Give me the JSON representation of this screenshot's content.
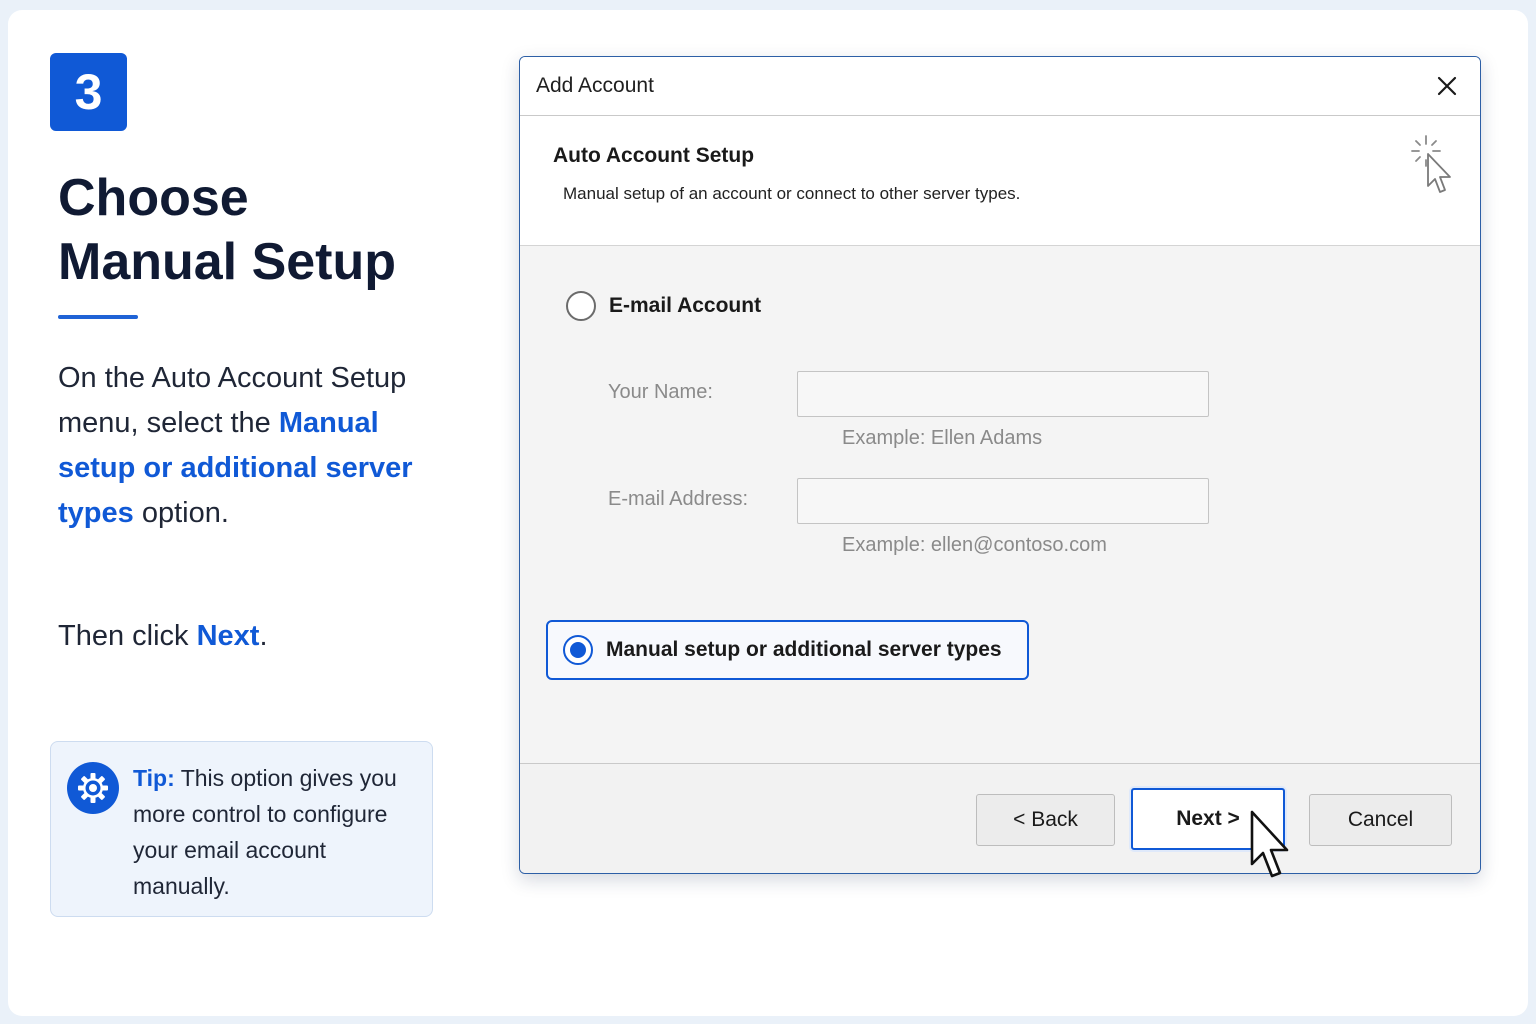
{
  "step": {
    "number": "3"
  },
  "heading": {
    "line1": "Choose",
    "line2": "Manual Setup"
  },
  "instructions": {
    "part1": "On the Auto Account Setup menu, select the ",
    "option_name": "Manual setup or additional server types",
    "part2": " option."
  },
  "then": {
    "prefix": "Then click ",
    "button_name": "Next",
    "suffix": "."
  },
  "tip": {
    "label": "Tip:",
    "text": " This option gives you more control to configure your email account manually."
  },
  "dialog": {
    "title": "Add Account",
    "section_title": "Auto Account Setup",
    "section_subtitle": "Manual setup of an account or connect to other server types.",
    "email_option": {
      "label": "E-mail Account",
      "checked": false
    },
    "name_field": {
      "label": "Your Name:",
      "value": "",
      "example": "Example: Ellen Adams"
    },
    "email_field": {
      "label": "E-mail Address:",
      "value": "",
      "example": "Example: ellen@contoso.com"
    },
    "manual_option": {
      "label": "Manual setup or additional server types",
      "checked": true
    },
    "buttons": {
      "back": "< Back",
      "next": "Next >",
      "cancel": "Cancel"
    }
  },
  "colors": {
    "accent": "#1059d6",
    "dialog_border": "#2d5fa6",
    "tip_background": "#eef4fc"
  },
  "icons": {
    "tip": "gear-icon",
    "close": "close-icon",
    "wizard": "wizard-cursor-icon",
    "pointer": "mouse-pointer-icon"
  }
}
